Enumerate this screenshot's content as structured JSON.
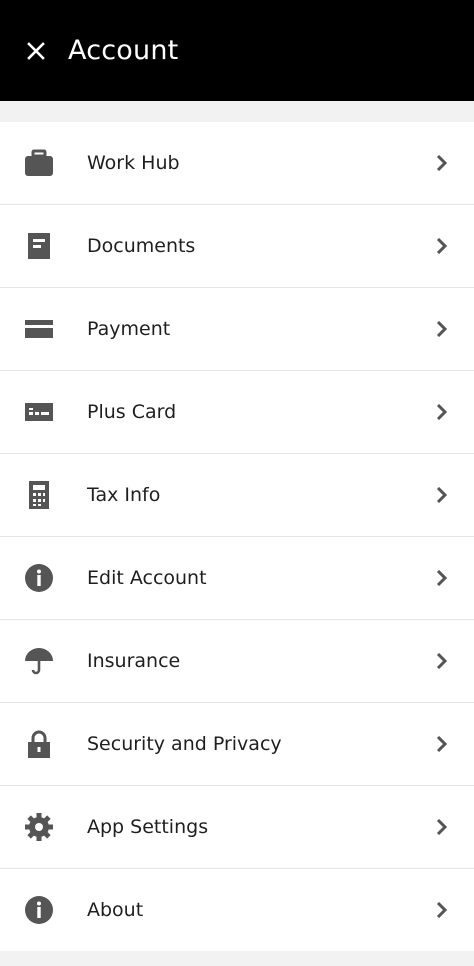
{
  "header": {
    "title": "Account",
    "close_icon": "close-icon"
  },
  "menu": [
    {
      "label": "Work Hub",
      "icon": "briefcase-icon"
    },
    {
      "label": "Documents",
      "icon": "document-icon"
    },
    {
      "label": "Payment",
      "icon": "credit-card-icon"
    },
    {
      "label": "Plus Card",
      "icon": "plus-card-icon"
    },
    {
      "label": "Tax Info",
      "icon": "calculator-icon"
    },
    {
      "label": "Edit Account",
      "icon": "info-icon"
    },
    {
      "label": "Insurance",
      "icon": "umbrella-icon"
    },
    {
      "label": "Security and Privacy",
      "icon": "lock-icon"
    },
    {
      "label": "App Settings",
      "icon": "gear-icon"
    },
    {
      "label": "About",
      "icon": "info-icon"
    }
  ],
  "colors": {
    "header_bg": "#000000",
    "icon": "#555555",
    "chevron": "#555555",
    "divider": "#e6e6e6",
    "page_bg": "#f2f2f2"
  }
}
